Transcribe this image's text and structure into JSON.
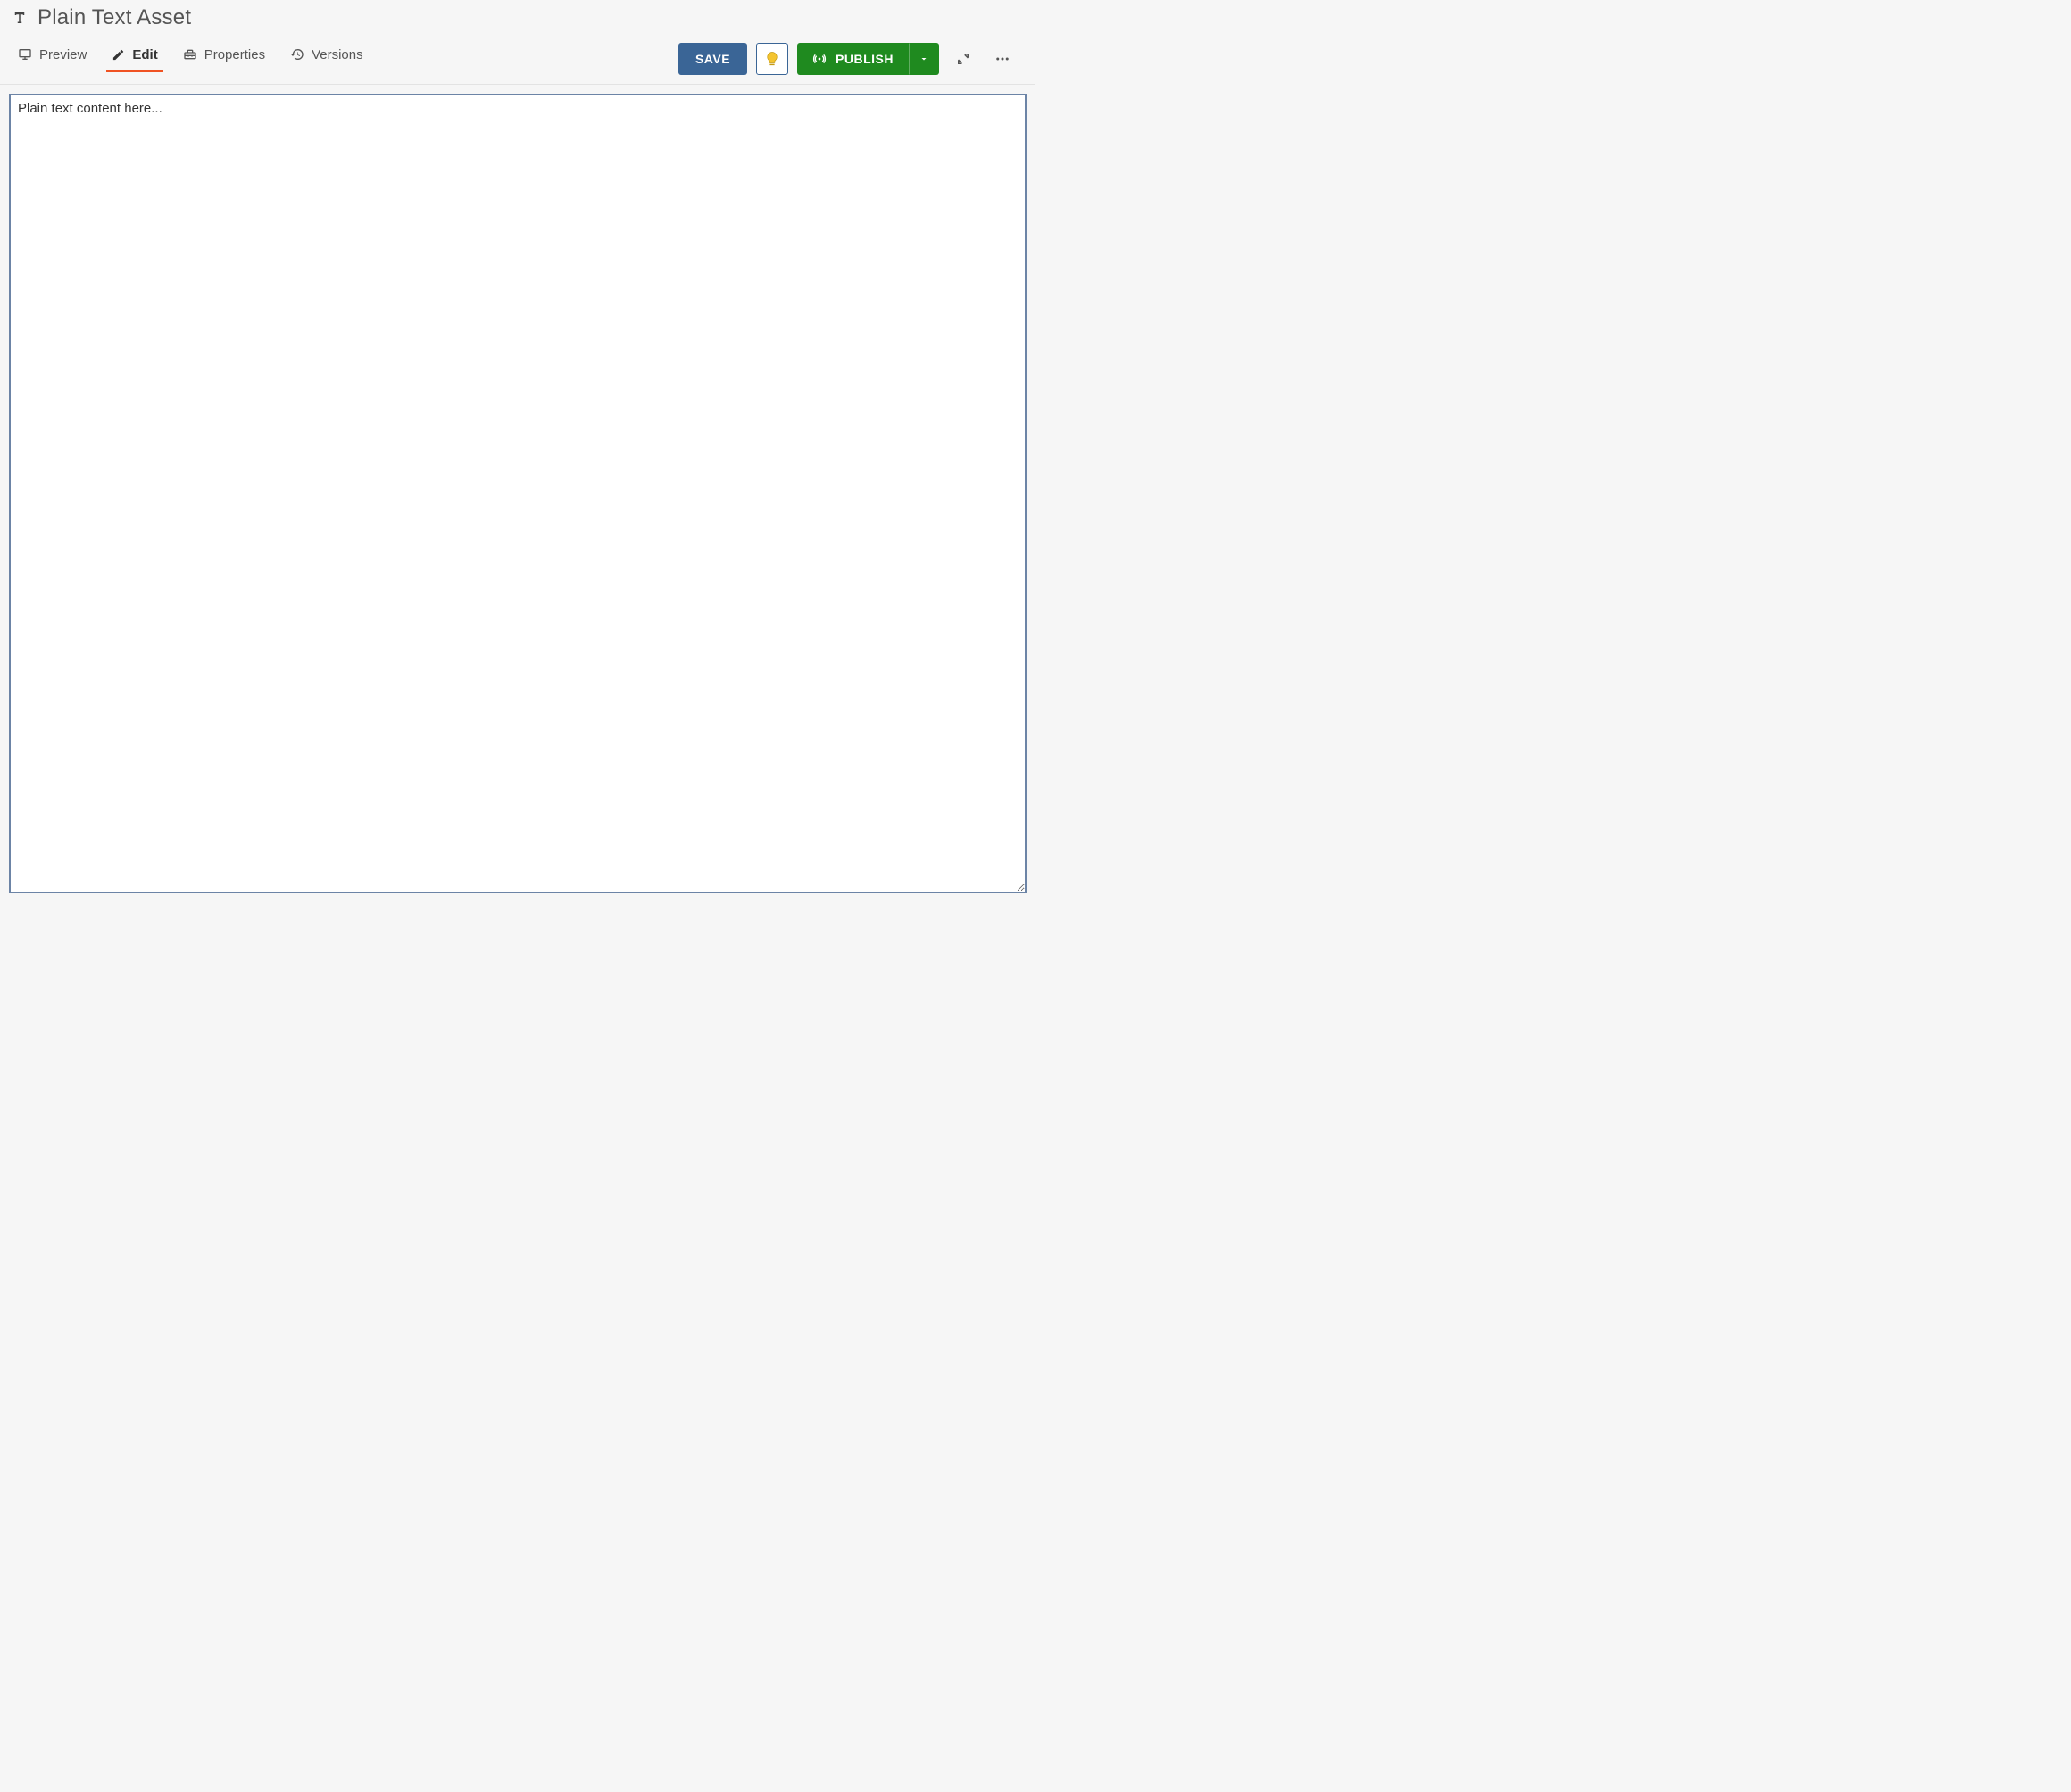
{
  "header": {
    "asset_type_icon": "text-type-icon",
    "title": "Plain Text Asset"
  },
  "tabs": {
    "preview": "Preview",
    "edit": "Edit",
    "properties": "Properties",
    "versions": "Versions",
    "active": "edit"
  },
  "actions": {
    "save": "SAVE",
    "publish": "PUBLISH"
  },
  "editor": {
    "content": "Plain text content here...",
    "placeholder": ""
  },
  "colors": {
    "accent_tab": "#f05323",
    "save_btn": "#3a6596",
    "publish_btn": "#1f8a1f",
    "editor_border": "#6c84a6",
    "bulb_fill": "#f4c430"
  }
}
